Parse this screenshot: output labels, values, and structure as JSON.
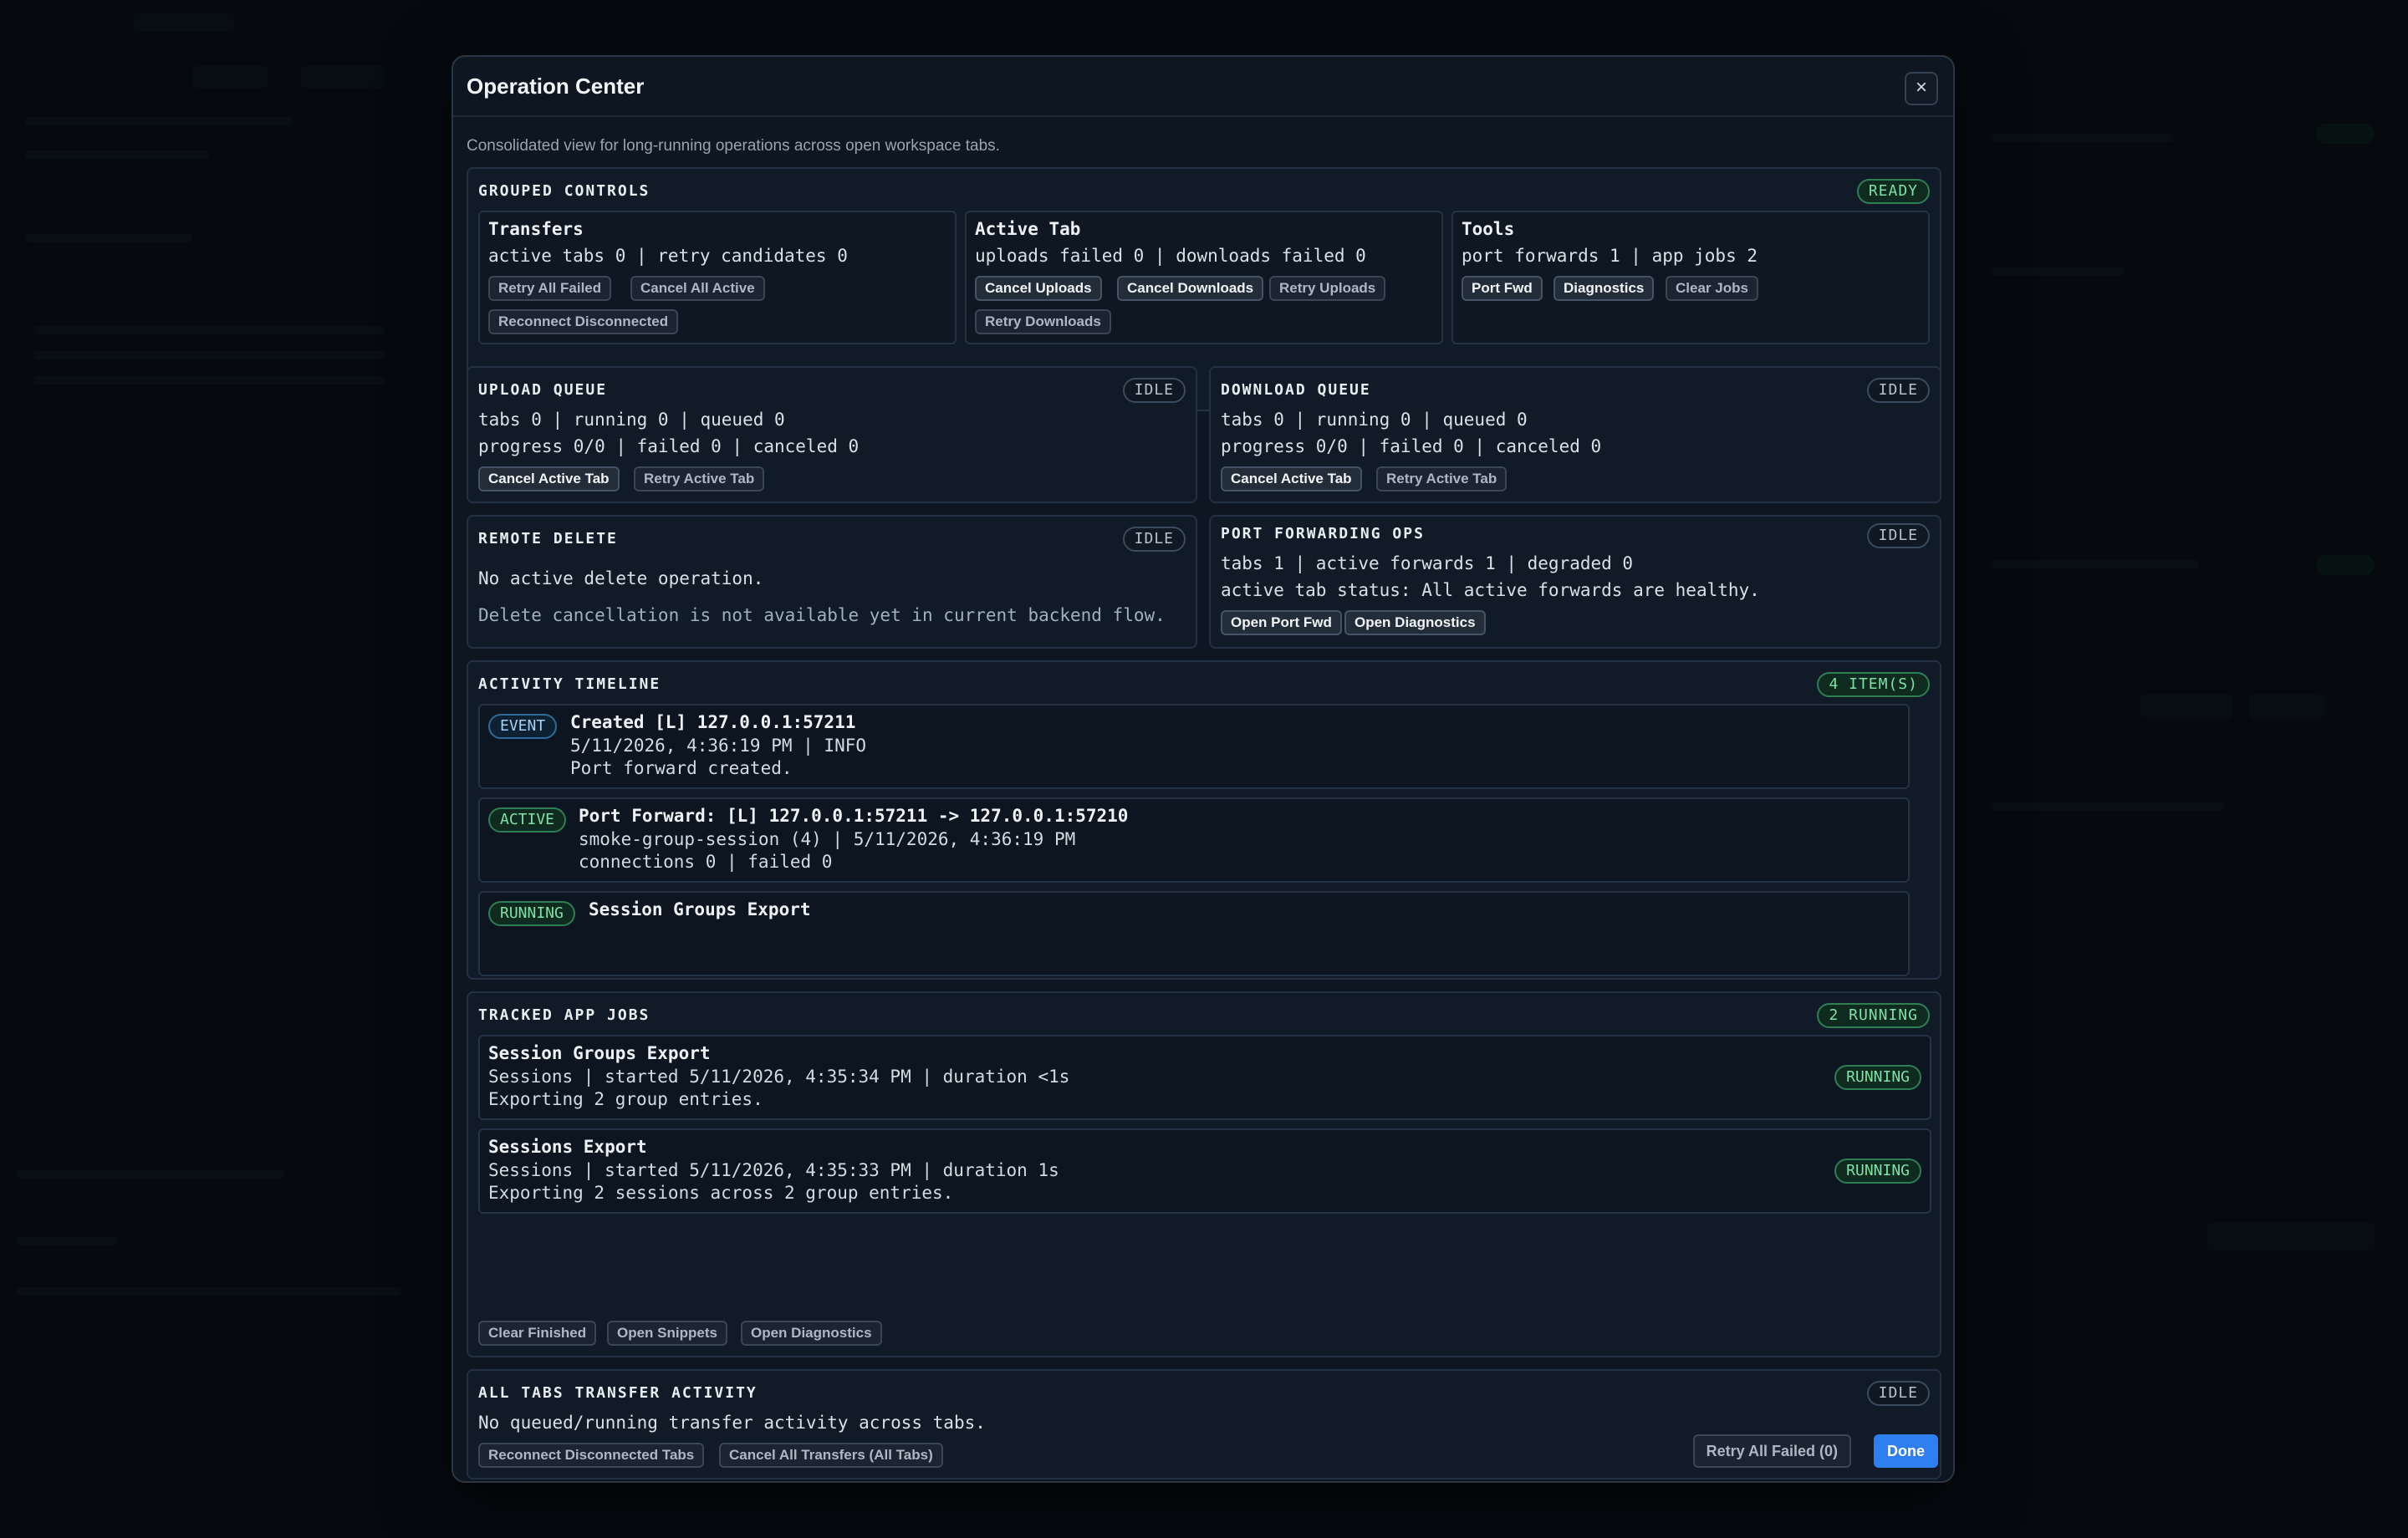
{
  "modal": {
    "title": "Operation Center",
    "close_label": "×",
    "subtitle": "Consolidated view for long-running operations across open workspace tabs."
  },
  "grouped_controls": {
    "title": "GROUPED CONTROLS",
    "badge": "READY",
    "transfers": {
      "title": "Transfers",
      "stats": "active tabs 0 | retry candidates 0",
      "buttons": [
        "Retry All Failed",
        "Cancel All Active",
        "Reconnect Disconnected"
      ]
    },
    "active_tab": {
      "title": "Active Tab",
      "stats": "uploads failed 0 | downloads failed 0",
      "buttons": [
        "Cancel Uploads",
        "Cancel Downloads",
        "Retry Uploads",
        "Retry Downloads"
      ]
    },
    "tools": {
      "title": "Tools",
      "stats": "port forwards 1 | app jobs 2",
      "buttons": [
        "Port Fwd",
        "Diagnostics",
        "Clear Jobs"
      ]
    }
  },
  "upload_queue": {
    "title": "UPLOAD QUEUE",
    "badge": "IDLE",
    "line1": "tabs 0 | running 0 | queued 0",
    "line2": "progress 0/0 | failed 0 | canceled 0",
    "buttons": [
      "Cancel Active Tab",
      "Retry Active Tab"
    ]
  },
  "download_queue": {
    "title": "DOWNLOAD QUEUE",
    "badge": "IDLE",
    "line1": "tabs 0 | running 0 | queued 0",
    "line2": "progress 0/0 | failed 0 | canceled 0",
    "buttons": [
      "Cancel Active Tab",
      "Retry Active Tab"
    ]
  },
  "remote_delete": {
    "title": "REMOTE DELETE",
    "badge": "IDLE",
    "line1": "No active delete operation.",
    "line2": "Delete cancellation is not available yet in current backend flow."
  },
  "port_forwarding": {
    "title": "PORT FORWARDING OPS",
    "badge": "IDLE",
    "line1": "tabs 1 | active forwards 1 | degraded 0",
    "line2": "active tab status: All active forwards are healthy.",
    "buttons": [
      "Open Port Fwd",
      "Open Diagnostics"
    ]
  },
  "activity_timeline": {
    "title": "ACTIVITY TIMELINE",
    "badge": "4 ITEM(S)",
    "items": [
      {
        "tag": "EVENT",
        "title": "Created [L] 127.0.0.1:57211",
        "line1": "5/11/2026, 4:36:19 PM | INFO",
        "line2": "Port forward created."
      },
      {
        "tag": "ACTIVE",
        "title": "Port Forward: [L] 127.0.0.1:57211 -> 127.0.0.1:57210",
        "line1": "smoke-group-session (4) | 5/11/2026, 4:36:19 PM",
        "line2": "connections 0 | failed 0"
      },
      {
        "tag": "RUNNING",
        "title": "Session Groups Export"
      }
    ]
  },
  "tracked_jobs": {
    "title": "TRACKED APP JOBS",
    "badge": "2 RUNNING",
    "jobs": [
      {
        "title": "Session Groups Export",
        "line1": "Sessions | started 5/11/2026, 4:35:34 PM | duration <1s",
        "line2": "Exporting 2 group entries.",
        "status": "RUNNING"
      },
      {
        "title": "Sessions Export",
        "line1": "Sessions | started 5/11/2026, 4:35:33 PM | duration 1s",
        "line2": "Exporting 2 sessions across 2 group entries.",
        "status": "RUNNING"
      }
    ],
    "buttons": [
      "Clear Finished",
      "Open Snippets",
      "Open Diagnostics"
    ]
  },
  "all_tabs": {
    "title": "ALL TABS TRANSFER ACTIVITY",
    "badge": "IDLE",
    "line1": "No queued/running transfer activity across tabs.",
    "buttons": [
      "Reconnect Disconnected Tabs",
      "Cancel All Transfers (All Tabs)"
    ]
  },
  "footer": {
    "retry_label": "Retry All Failed (0)",
    "done_label": "Done"
  }
}
